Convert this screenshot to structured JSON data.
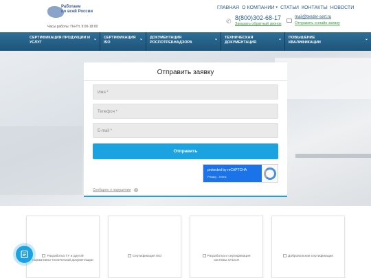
{
  "header": {
    "logo_line1": "Работаем",
    "logo_line2": "по всей России",
    "hours": "Часы работы: Пн-Пт, 9:00-18:00",
    "topnav": [
      {
        "label": "ГЛАВНАЯ"
      },
      {
        "label": "О КОМПАНИИ"
      },
      {
        "label": "СТАТЬИ"
      },
      {
        "label": "КОНТАКТЫ"
      },
      {
        "label": "НОВОСТИ"
      }
    ],
    "phone": "8(800)302-68-17",
    "callback": "Заказать обратный звонок",
    "email": "mail@tender-sert.ru",
    "online_request": "Отправить онлайн-заявку"
  },
  "navbar": {
    "items": [
      {
        "line1": "СЕРТИФИКАЦИЯ ПРОДУКЦИИ И",
        "line2": "УСЛУГ"
      },
      {
        "line1": "СЕРТИФИКАЦИЯ",
        "line2": "ISO"
      },
      {
        "line1": "ДОКУМЕНТАЦИЯ",
        "line2": "РОСПОТРЕБНАДЗОРА"
      },
      {
        "line1": "ТЕХНИЧЕСКАЯ",
        "line2": "ДОКУМЕНТАЦИЯ"
      },
      {
        "line1": "ПОВЫШЕНИЕ",
        "line2": "КВАЛИФИКАЦИИ"
      }
    ]
  },
  "form": {
    "title": "Отправить заявку",
    "name_placeholder": "Имя *",
    "phone_placeholder": "Телефон *",
    "email_placeholder": "E-mail *",
    "submit_label": "Отправить",
    "captcha_line1": "protected by reCAPTCHA",
    "captcha_line2": "Privacy - Terms",
    "report_label": "Сообщить о нарушении",
    "help_label": "?"
  },
  "cards": [
    {
      "alt": "Разработка ТУ и другой нормативно-технической документации"
    },
    {
      "alt": "Сертификация ISO"
    },
    {
      "alt": "Разработка и сертификация системы ХАССП"
    },
    {
      "alt": "Добровольная сертификация"
    }
  ],
  "colors": {
    "accent": "#1aa3e0",
    "navbar": "#1d5479",
    "link": "#2a5d93",
    "green_link": "#3a9a3a"
  },
  "icons": {
    "phone": "phone-icon",
    "mail": "mail-icon",
    "chat": "chat-icon",
    "chevron": "chevron-down-icon"
  }
}
